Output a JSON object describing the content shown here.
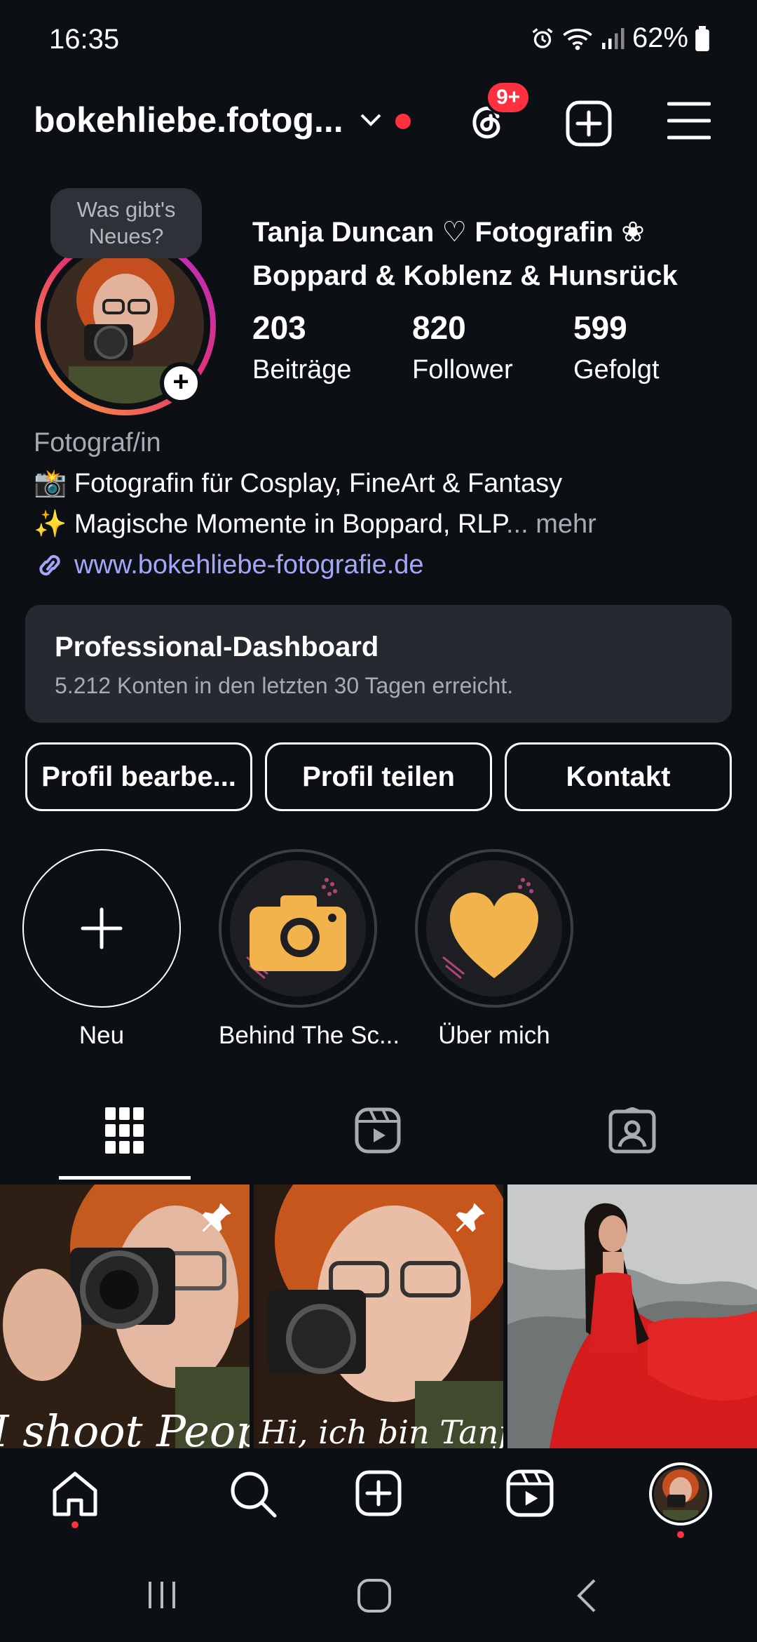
{
  "status": {
    "time": "16:35",
    "battery": "62%"
  },
  "header": {
    "username": "bokehliebe.fotog...",
    "badge": "9+"
  },
  "profile": {
    "story_bubble": "Was gibt's Neues?",
    "name_line1": "Tanja Duncan ♡ Fotografin ❀",
    "name_line2": "Boppard & Koblenz &  Hunsrück",
    "stats": [
      {
        "value": "203",
        "label": "Beiträge"
      },
      {
        "value": "820",
        "label": "Follower"
      },
      {
        "value": "599",
        "label": "Gefolgt"
      }
    ],
    "category": "Fotograf/in",
    "bio_line1": "📸 Fotografin für Cosplay, FineArt & Fantasy",
    "bio_line2": "✨ Magische Momente in Boppard, RLP",
    "bio_ellipsis": "...",
    "bio_more": "mehr",
    "link": "www.bokehliebe-fotografie.de"
  },
  "dashboard": {
    "title": "Professional-Dashboard",
    "subtitle": "5.212 Konten in den letzten 30 Tagen erreicht."
  },
  "buttons": {
    "edit": "Profil bearbe...",
    "share": "Profil teilen",
    "contact": "Kontakt"
  },
  "highlights": [
    {
      "label": "Neu"
    },
    {
      "label": "Behind The Sc..."
    },
    {
      "label": "Über mich"
    }
  ],
  "posts": [
    {
      "caption": "I shoot People"
    },
    {
      "caption": "Hi, ich bin Tanja"
    }
  ],
  "colors": {
    "background": "#0c1015",
    "accent_red": "#ff3040",
    "link": "#a3a7f7",
    "highlight_yellow": "#f2b34c"
  },
  "icons": {
    "topbar": [
      "chevron-down-icon",
      "threads-icon",
      "create-plus-icon",
      "menu-icon"
    ],
    "tabs": [
      "grid-icon",
      "reels-icon",
      "tagged-icon"
    ],
    "bottomnav": [
      "home-icon",
      "search-icon",
      "create-icon",
      "reels-icon",
      "profile-avatar"
    ],
    "sysnav": [
      "recents-icon",
      "home-circle-icon",
      "back-icon"
    ]
  }
}
